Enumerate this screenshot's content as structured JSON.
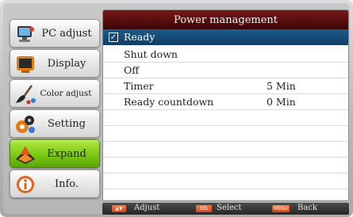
{
  "menu": {
    "items": [
      {
        "label": "PC adjust",
        "icon": "pc-adjust-icon"
      },
      {
        "label": "Display",
        "icon": "display-icon"
      },
      {
        "label": "Color adjust",
        "icon": "color-adjust-icon"
      },
      {
        "label": "Setting",
        "icon": "setting-icon"
      },
      {
        "label": "Expand",
        "icon": "expand-icon",
        "active": true
      },
      {
        "label": "Info.",
        "icon": "info-icon"
      }
    ],
    "active_color": "#7fcc16"
  },
  "panel": {
    "title": "Power management",
    "title_color": "#5a0c0c",
    "rows": [
      {
        "label": "Ready",
        "value": "",
        "checked": true,
        "selected": true
      },
      {
        "label": "Shut down",
        "value": ""
      },
      {
        "label": "Off",
        "value": ""
      },
      {
        "label": "Timer",
        "value": "5 Min"
      },
      {
        "label": "Ready countdown",
        "value": "0 Min"
      }
    ],
    "selected_color": "#1e5a8a"
  },
  "hints": {
    "adjust": {
      "key": "▲▼",
      "label": "Adjust"
    },
    "select": {
      "key": "SEL",
      "label": "Select"
    },
    "back": {
      "key": "MENU",
      "label": "Back"
    }
  }
}
